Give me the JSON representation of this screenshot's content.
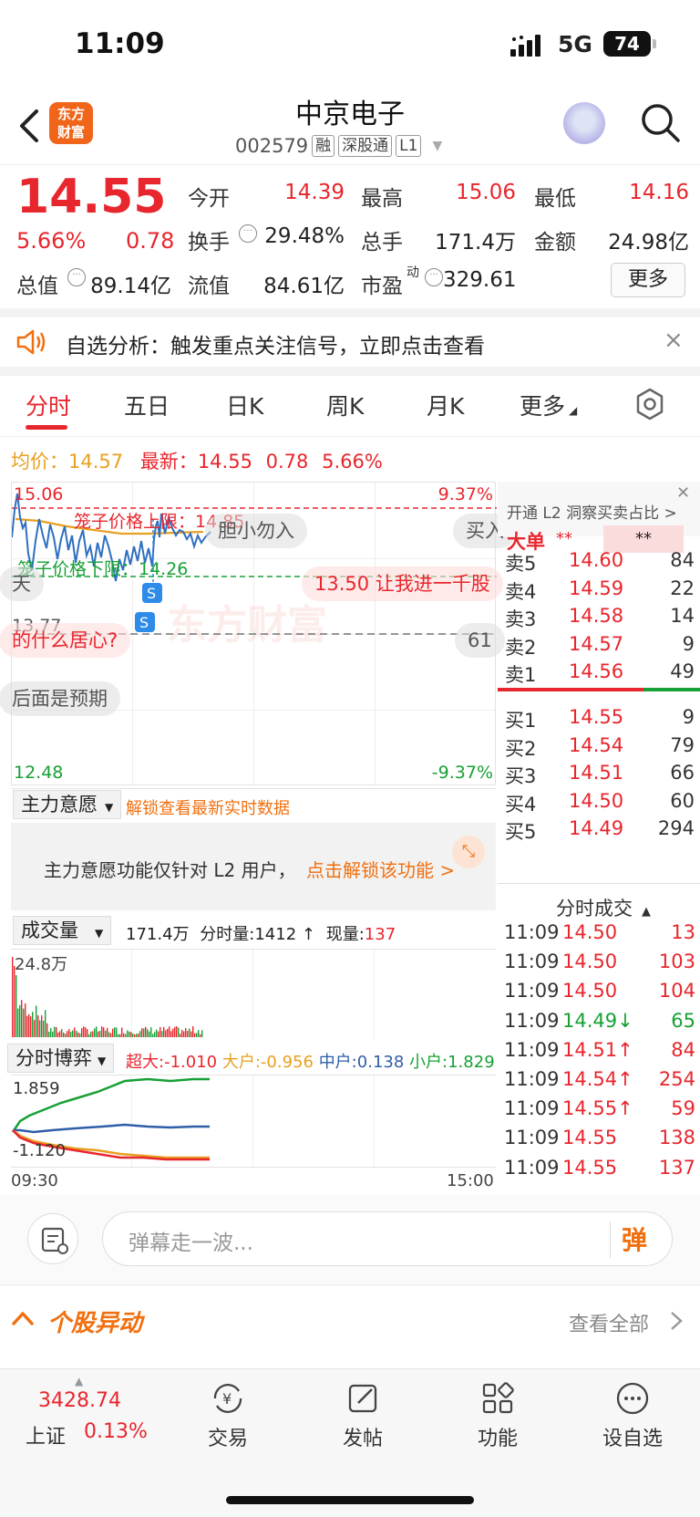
{
  "status": {
    "time": "11:09",
    "network": "5G",
    "battery": "74"
  },
  "header": {
    "logo_line1": "东方",
    "logo_line2": "财富",
    "name": "中京电子",
    "code": "002579",
    "tags": [
      "融",
      "深股通",
      "L1"
    ]
  },
  "quote": {
    "last": "14.55",
    "chg_pct": "5.66%",
    "chg_amt": "0.78",
    "open_label": "今开",
    "open": "14.39",
    "high_label": "最高",
    "high": "15.06",
    "low_label": "最低",
    "low": "14.16",
    "turnover_label": "换手",
    "turnover": "29.48%",
    "volume_label": "总手",
    "volume": "171.4万",
    "amount_label": "金额",
    "amount": "24.98亿",
    "mktcap_label": "总值",
    "mktcap": "89.14亿",
    "float_label": "流值",
    "float": "84.61亿",
    "pe_label": "市盈",
    "pe_sup": "动",
    "pe": "329.61",
    "more": "更多"
  },
  "notice": {
    "text": "自选分析：触发重点关注信号，立即点击查看",
    "close": "×"
  },
  "tabs": [
    "分时",
    "五日",
    "日K",
    "周K",
    "月K",
    "更多"
  ],
  "avg_row": {
    "avg_label": "均价：",
    "avg": "14.57",
    "latest_label": "最新：",
    "latest": "14.55",
    "chg": "0.78",
    "pct": "5.66%"
  },
  "chart": {
    "high_label": "15.06",
    "low_label": "12.48",
    "pct_top": "9.37%",
    "pct_bot": "-9.37%",
    "mid_label": "13.77",
    "upper_limit": "笼子价格上限：14.85",
    "lower_limit": "笼子价格下限：14.26",
    "bullets": [
      "胆小勿入",
      "买入",
      "13.50 让我进一千股",
      "的什么居心?",
      "61",
      "后面是预期",
      "天"
    ],
    "watermark": "东方财富"
  },
  "orderbook": {
    "header": "开通 L2 洞察买卖占比 >",
    "big_label": "大单",
    "big_val1": "**",
    "big_val2": "**",
    "asks": [
      {
        "label": "卖5",
        "price": "14.60",
        "vol": "84"
      },
      {
        "label": "卖4",
        "price": "14.59",
        "vol": "22"
      },
      {
        "label": "卖3",
        "price": "14.58",
        "vol": "14"
      },
      {
        "label": "卖2",
        "price": "14.57",
        "vol": "9"
      },
      {
        "label": "卖1",
        "price": "14.56",
        "vol": "49"
      }
    ],
    "bids": [
      {
        "label": "买1",
        "price": "14.55",
        "vol": "9"
      },
      {
        "label": "买2",
        "price": "14.54",
        "vol": "79"
      },
      {
        "label": "买3",
        "price": "14.51",
        "vol": "66"
      },
      {
        "label": "买4",
        "price": "14.50",
        "vol": "60"
      },
      {
        "label": "买5",
        "price": "14.49",
        "vol": "294"
      }
    ]
  },
  "ticks": {
    "title": "分时成交",
    "rows": [
      {
        "time": "11:09",
        "price": "14.50",
        "vol": "13",
        "dir": "",
        "c": "red"
      },
      {
        "time": "11:09",
        "price": "14.50",
        "vol": "103",
        "dir": "",
        "c": "red"
      },
      {
        "time": "11:09",
        "price": "14.50",
        "vol": "104",
        "dir": "",
        "c": "red"
      },
      {
        "time": "11:09",
        "price": "14.49↓",
        "vol": "65",
        "dir": "down",
        "c": "green"
      },
      {
        "time": "11:09",
        "price": "14.51↑",
        "vol": "84",
        "dir": "up",
        "c": "red"
      },
      {
        "time": "11:09",
        "price": "14.54↑",
        "vol": "254",
        "dir": "up",
        "c": "red"
      },
      {
        "time": "11:09",
        "price": "14.55↑",
        "vol": "59",
        "dir": "up",
        "c": "red"
      },
      {
        "time": "11:09",
        "price": "14.55",
        "vol": "138",
        "dir": "",
        "c": "red"
      },
      {
        "time": "11:09",
        "price": "14.55",
        "vol": "137",
        "dir": "",
        "c": "red"
      }
    ]
  },
  "main_force": {
    "dropdown": "主力意愿",
    "unlock_link": "解锁查看最新实时数据",
    "card_text": "主力意愿功能仅针对 L2 用户，",
    "card_link": "点击解锁该功能 >"
  },
  "volume_panel": {
    "dropdown": "成交量",
    "total": "171.4万",
    "fenshi_label": "分时量:",
    "fenshi_val": "1412",
    "arrow": "↑",
    "now_label": "现量:",
    "now_val": "137",
    "max_label": "24.8万"
  },
  "game_panel": {
    "dropdown": "分时博弈",
    "super_label": "超大:",
    "super_val": "-1.010",
    "large_label": "大户:",
    "large_val": "-0.956",
    "mid_label": "中户:",
    "mid_val": "0.138",
    "small_label": "小户:",
    "small_val": "1.829",
    "top_val": "1.859",
    "bot_val": "-1.120",
    "time_start": "09:30",
    "time_end": "15:00"
  },
  "danmu": {
    "placeholder": "弹幕走一波...",
    "send": "弹"
  },
  "alert": {
    "title": "个股异动",
    "view_all": "查看全部"
  },
  "nav": {
    "index_val": "3428.74",
    "index_name": "上证",
    "index_pct": "0.13%",
    "items": [
      "交易",
      "发帖",
      "功能",
      "设自选"
    ]
  },
  "colors": {
    "up": "#e8262d",
    "down": "#17a035",
    "accent": "#f07010",
    "avg": "#e8a020"
  }
}
